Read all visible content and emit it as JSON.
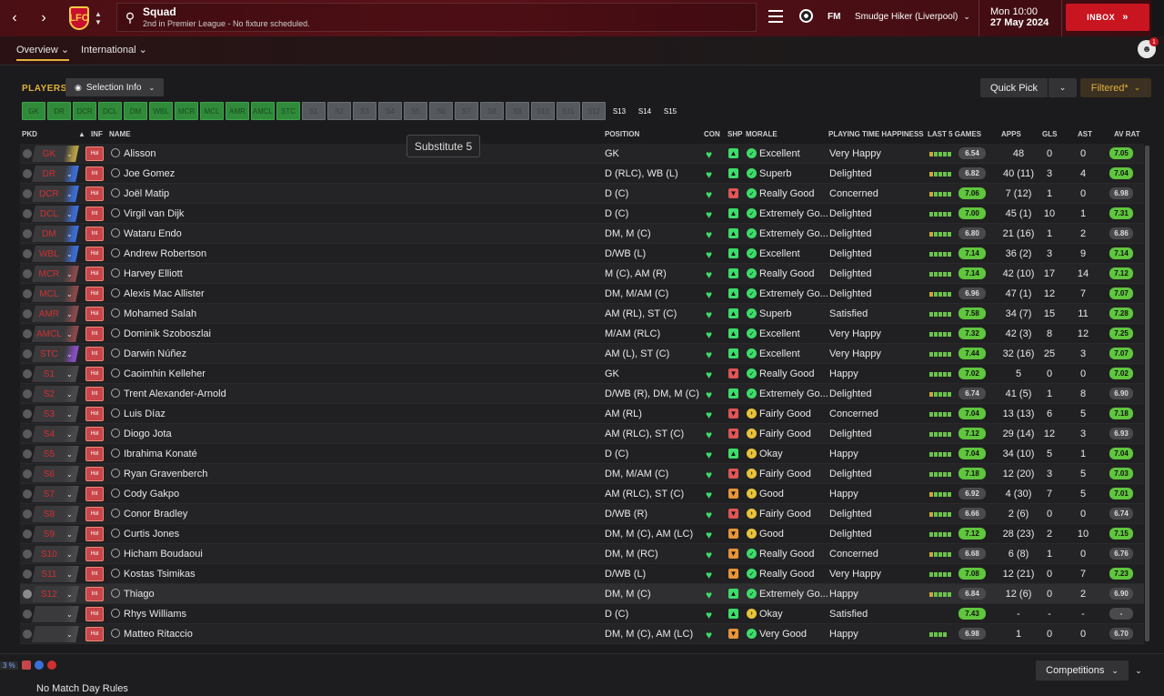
{
  "topbar": {
    "title": "Squad",
    "subtitle": "2nd in Premier League - No fixture scheduled.",
    "club_badge": "LFC",
    "fm_logo": "FM",
    "manager": "Smudge Hiker (Liverpool)",
    "date_line1": "Mon 10:00",
    "date_line2": "27 May 2024",
    "inbox_label": "INBOX",
    "arrow_glyph": "»"
  },
  "tabs": {
    "overview": "Overview",
    "international": "International"
  },
  "players_bar": {
    "label": "PLAYERS",
    "selection_info": "Selection Info",
    "quick_pick": "Quick Pick",
    "filtered": "Filtered*"
  },
  "chips": {
    "filled": [
      "GK",
      "DR",
      "DCR",
      "DCL",
      "DM",
      "WBL",
      "MCR",
      "MCL",
      "AMR",
      "AMCL",
      "STC"
    ],
    "sub": [
      "S1",
      "S2",
      "S3",
      "S4",
      "S5",
      "S6",
      "S7",
      "S8",
      "S9",
      "S10",
      "S11",
      "S12"
    ],
    "free": [
      "S13",
      "S14",
      "S15"
    ]
  },
  "columns": {
    "pkd": "PKD",
    "inf": "INF",
    "name": "NAME",
    "position": "POSITION",
    "con": "CON",
    "shp": "SHP",
    "morale": "MORALE",
    "pth": "PLAYING TIME HAPPINESS",
    "last5": "LAST 5 GAMES",
    "apps": "APPS",
    "gls": "GLS",
    "ast": "AST",
    "avrat": "AV RAT"
  },
  "tooltip": "Substitute 5",
  "colors": {
    "accent": "#e2b13c",
    "inbox": "#c8151f",
    "rating_green": "#5fc63d",
    "rating_grey": "#4a4a4c"
  },
  "rows": [
    {
      "pos": "GK",
      "inf": "Hol",
      "name": "Alisson",
      "position": "GK",
      "shp": "up",
      "morale": "Excellent",
      "mor": "up",
      "pth": "Very Happy",
      "form": [
        0,
        1,
        1,
        1,
        1
      ],
      "last": "6.54",
      "lg": false,
      "apps": "48",
      "gls": "0",
      "ast": "0",
      "av": "7.05",
      "ag": true
    },
    {
      "pos": "DR",
      "inf": "Int",
      "name": "Joe Gomez",
      "position": "D (RLC), WB (L)",
      "shp": "up",
      "morale": "Superb",
      "mor": "up",
      "pth": "Delighted",
      "form": [
        0,
        1,
        1,
        1,
        1
      ],
      "last": "6.82",
      "lg": false,
      "apps": "40 (11)",
      "gls": "3",
      "ast": "4",
      "av": "7.04",
      "ag": true
    },
    {
      "pos": "DCR",
      "inf": "Hol",
      "name": "Joël Matip",
      "position": "D (C)",
      "shp": "down",
      "morale": "Really Good",
      "mor": "up",
      "pth": "Concerned",
      "form": [
        0,
        1,
        1,
        1,
        1
      ],
      "last": "7.06",
      "lg": true,
      "apps": "7 (12)",
      "gls": "1",
      "ast": "0",
      "av": "6.98",
      "ag": false
    },
    {
      "pos": "DCL",
      "inf": "Int",
      "name": "Virgil van Dijk",
      "position": "D (C)",
      "shp": "up",
      "morale": "Extremely Go...",
      "mor": "up",
      "pth": "Delighted",
      "form": [
        1,
        1,
        1,
        1,
        1
      ],
      "last": "7.00",
      "lg": true,
      "apps": "45 (1)",
      "gls": "10",
      "ast": "1",
      "av": "7.31",
      "ag": true
    },
    {
      "pos": "DM",
      "inf": "Int",
      "name": "Wataru Endo",
      "position": "DM, M (C)",
      "shp": "up",
      "morale": "Extremely Go...",
      "mor": "up",
      "pth": "Delighted",
      "form": [
        0,
        1,
        1,
        1,
        1
      ],
      "last": "6.80",
      "lg": false,
      "apps": "21 (16)",
      "gls": "1",
      "ast": "2",
      "av": "6.86",
      "ag": false
    },
    {
      "pos": "WBL",
      "inf": "Hol",
      "name": "Andrew Robertson",
      "position": "D/WB (L)",
      "shp": "up",
      "morale": "Excellent",
      "mor": "up",
      "pth": "Delighted",
      "form": [
        1,
        1,
        1,
        1,
        1
      ],
      "last": "7.14",
      "lg": true,
      "apps": "36 (2)",
      "gls": "3",
      "ast": "9",
      "av": "7.14",
      "ag": true
    },
    {
      "pos": "MCR",
      "inf": "Hol",
      "name": "Harvey Elliott",
      "position": "M (C), AM (R)",
      "shp": "up",
      "morale": "Really Good",
      "mor": "up",
      "pth": "Delighted",
      "form": [
        1,
        1,
        1,
        1,
        1
      ],
      "last": "7.14",
      "lg": true,
      "apps": "42 (10)",
      "gls": "17",
      "ast": "14",
      "av": "7.12",
      "ag": true
    },
    {
      "pos": "MCL",
      "inf": "Hol",
      "name": "Alexis Mac Allister",
      "position": "DM, M/AM (C)",
      "shp": "up",
      "morale": "Extremely Go...",
      "mor": "up",
      "pth": "Delighted",
      "form": [
        0,
        1,
        1,
        1,
        1
      ],
      "last": "6.96",
      "lg": false,
      "apps": "47 (1)",
      "gls": "12",
      "ast": "7",
      "av": "7.07",
      "ag": true
    },
    {
      "pos": "AMR",
      "inf": "Hol",
      "name": "Mohamed Salah",
      "position": "AM (RL), ST (C)",
      "shp": "up",
      "morale": "Superb",
      "mor": "up",
      "pth": "Satisfied",
      "form": [
        1,
        1,
        1,
        1,
        1
      ],
      "last": "7.58",
      "lg": true,
      "apps": "34 (7)",
      "gls": "15",
      "ast": "11",
      "av": "7.28",
      "ag": true
    },
    {
      "pos": "AMCL",
      "inf": "Int",
      "name": "Dominik Szoboszlai",
      "position": "M/AM (RLC)",
      "shp": "up",
      "morale": "Excellent",
      "mor": "up",
      "pth": "Very Happy",
      "form": [
        1,
        1,
        1,
        1,
        1
      ],
      "last": "7.32",
      "lg": true,
      "apps": "42 (3)",
      "gls": "8",
      "ast": "12",
      "av": "7.25",
      "ag": true
    },
    {
      "pos": "STC",
      "inf": "Int",
      "name": "Darwin Núñez",
      "position": "AM (L), ST (C)",
      "shp": "up",
      "morale": "Excellent",
      "mor": "up",
      "pth": "Very Happy",
      "form": [
        1,
        1,
        1,
        1,
        1
      ],
      "last": "7.44",
      "lg": true,
      "apps": "32 (16)",
      "gls": "25",
      "ast": "3",
      "av": "7.07",
      "ag": true
    },
    {
      "pos": "S1",
      "inf": "Hol",
      "name": "Caoimhin Kelleher",
      "position": "GK",
      "shp": "down",
      "morale": "Really Good",
      "mor": "up",
      "pth": "Happy",
      "form": [
        1,
        1,
        1,
        1,
        1
      ],
      "last": "7.02",
      "lg": true,
      "apps": "5",
      "gls": "0",
      "ast": "0",
      "av": "7.02",
      "ag": true
    },
    {
      "pos": "S2",
      "inf": "Int",
      "name": "Trent Alexander-Arnold",
      "position": "D/WB (R), DM, M (C)",
      "shp": "up",
      "morale": "Extremely Go...",
      "mor": "up",
      "pth": "Delighted",
      "form": [
        0,
        1,
        1,
        1,
        1
      ],
      "last": "6.74",
      "lg": false,
      "apps": "41 (5)",
      "gls": "1",
      "ast": "8",
      "av": "6.90",
      "ag": false
    },
    {
      "pos": "S3",
      "inf": "Hol",
      "name": "Luis Díaz",
      "position": "AM (RL)",
      "shp": "down",
      "morale": "Fairly Good",
      "mor": "flat",
      "pth": "Concerned",
      "form": [
        1,
        1,
        1,
        1,
        1
      ],
      "last": "7.04",
      "lg": true,
      "apps": "13 (13)",
      "gls": "6",
      "ast": "5",
      "av": "7.18",
      "ag": true
    },
    {
      "pos": "S4",
      "inf": "Hol",
      "name": "Diogo Jota",
      "position": "AM (RLC), ST (C)",
      "shp": "down",
      "morale": "Fairly Good",
      "mor": "flat",
      "pth": "Delighted",
      "form": [
        1,
        1,
        1,
        1,
        1
      ],
      "last": "7.12",
      "lg": true,
      "apps": "29 (14)",
      "gls": "12",
      "ast": "3",
      "av": "6.93",
      "ag": false
    },
    {
      "pos": "S5",
      "inf": "Hol",
      "name": "Ibrahima Konaté",
      "position": "D (C)",
      "shp": "mid",
      "morale": "Okay",
      "mor": "flat",
      "pth": "Happy",
      "form": [
        1,
        1,
        1,
        1,
        1
      ],
      "last": "7.04",
      "lg": true,
      "apps": "34 (10)",
      "gls": "5",
      "ast": "1",
      "av": "7.04",
      "ag": true
    },
    {
      "pos": "S6",
      "inf": "Hol",
      "name": "Ryan Gravenberch",
      "position": "DM, M/AM (C)",
      "shp": "down",
      "morale": "Fairly Good",
      "mor": "flat",
      "pth": "Delighted",
      "form": [
        1,
        1,
        1,
        1,
        1
      ],
      "last": "7.18",
      "lg": true,
      "apps": "12 (20)",
      "gls": "3",
      "ast": "5",
      "av": "7.03",
      "ag": true
    },
    {
      "pos": "S7",
      "inf": "Int",
      "name": "Cody Gakpo",
      "position": "AM (RLC), ST (C)",
      "shp": "warn",
      "morale": "Good",
      "mor": "flat",
      "pth": "Happy",
      "form": [
        0,
        1,
        1,
        1,
        1
      ],
      "last": "6.92",
      "lg": false,
      "apps": "4 (30)",
      "gls": "7",
      "ast": "5",
      "av": "7.01",
      "ag": true
    },
    {
      "pos": "S8",
      "inf": "Hol",
      "name": "Conor Bradley",
      "position": "D/WB (R)",
      "shp": "down",
      "morale": "Fairly Good",
      "mor": "flat",
      "pth": "Delighted",
      "form": [
        0,
        1,
        1,
        1,
        1
      ],
      "last": "6.66",
      "lg": false,
      "apps": "2 (6)",
      "gls": "0",
      "ast": "0",
      "av": "6.74",
      "ag": false
    },
    {
      "pos": "S9",
      "inf": "Hol",
      "name": "Curtis Jones",
      "position": "DM, M (C), AM (LC)",
      "shp": "warn",
      "morale": "Good",
      "mor": "flat",
      "pth": "Delighted",
      "form": [
        1,
        1,
        1,
        1,
        1
      ],
      "last": "7.12",
      "lg": true,
      "apps": "28 (23)",
      "gls": "2",
      "ast": "10",
      "av": "7.15",
      "ag": true
    },
    {
      "pos": "S10",
      "inf": "Hol",
      "name": "Hicham Boudaoui",
      "position": "DM, M (RC)",
      "shp": "warn",
      "morale": "Really Good",
      "mor": "up",
      "pth": "Concerned",
      "form": [
        0,
        1,
        1,
        1,
        1
      ],
      "last": "6.68",
      "lg": false,
      "apps": "6 (8)",
      "gls": "1",
      "ast": "0",
      "av": "6.76",
      "ag": false
    },
    {
      "pos": "S11",
      "inf": "Int",
      "name": "Kostas Tsimikas",
      "position": "D/WB (L)",
      "shp": "warn",
      "morale": "Really Good",
      "mor": "up",
      "pth": "Very Happy",
      "form": [
        1,
        1,
        1,
        1,
        1
      ],
      "last": "7.08",
      "lg": true,
      "apps": "12 (21)",
      "gls": "0",
      "ast": "7",
      "av": "7.23",
      "ag": true
    },
    {
      "pos": "S12",
      "inf": "Int",
      "name": "Thiago",
      "position": "DM, M (C)",
      "shp": "up",
      "morale": "Extremely Go...",
      "mor": "up",
      "pth": "Happy",
      "form": [
        0,
        1,
        1,
        1,
        1
      ],
      "last": "6.84",
      "lg": false,
      "apps": "12 (6)",
      "gls": "0",
      "ast": "2",
      "av": "6.90",
      "ag": false,
      "selected": true
    },
    {
      "pos": "",
      "inf": "Hol",
      "name": "Rhys Williams",
      "position": "D (C)",
      "shp": "up",
      "morale": "Okay",
      "mor": "flat",
      "pth": "Satisfied",
      "form": [],
      "last": "7.43",
      "lg": true,
      "apps": "-",
      "gls": "-",
      "ast": "-",
      "av": "-",
      "ag": false
    },
    {
      "pos": "",
      "inf": "Hol",
      "name": "Matteo Ritaccio",
      "position": "DM, M (C), AM (LC)",
      "shp": "warn",
      "morale": "Very Good",
      "mor": "up",
      "pth": "Happy",
      "form": [
        1,
        1,
        1,
        1
      ],
      "last": "6.98",
      "lg": false,
      "apps": "1",
      "gls": "0",
      "ast": "0",
      "av": "6.70",
      "ag": false
    }
  ],
  "footer": {
    "no_rules": "No Match Day Rules",
    "competitions": "Competitions",
    "status_pct": "3 %"
  }
}
